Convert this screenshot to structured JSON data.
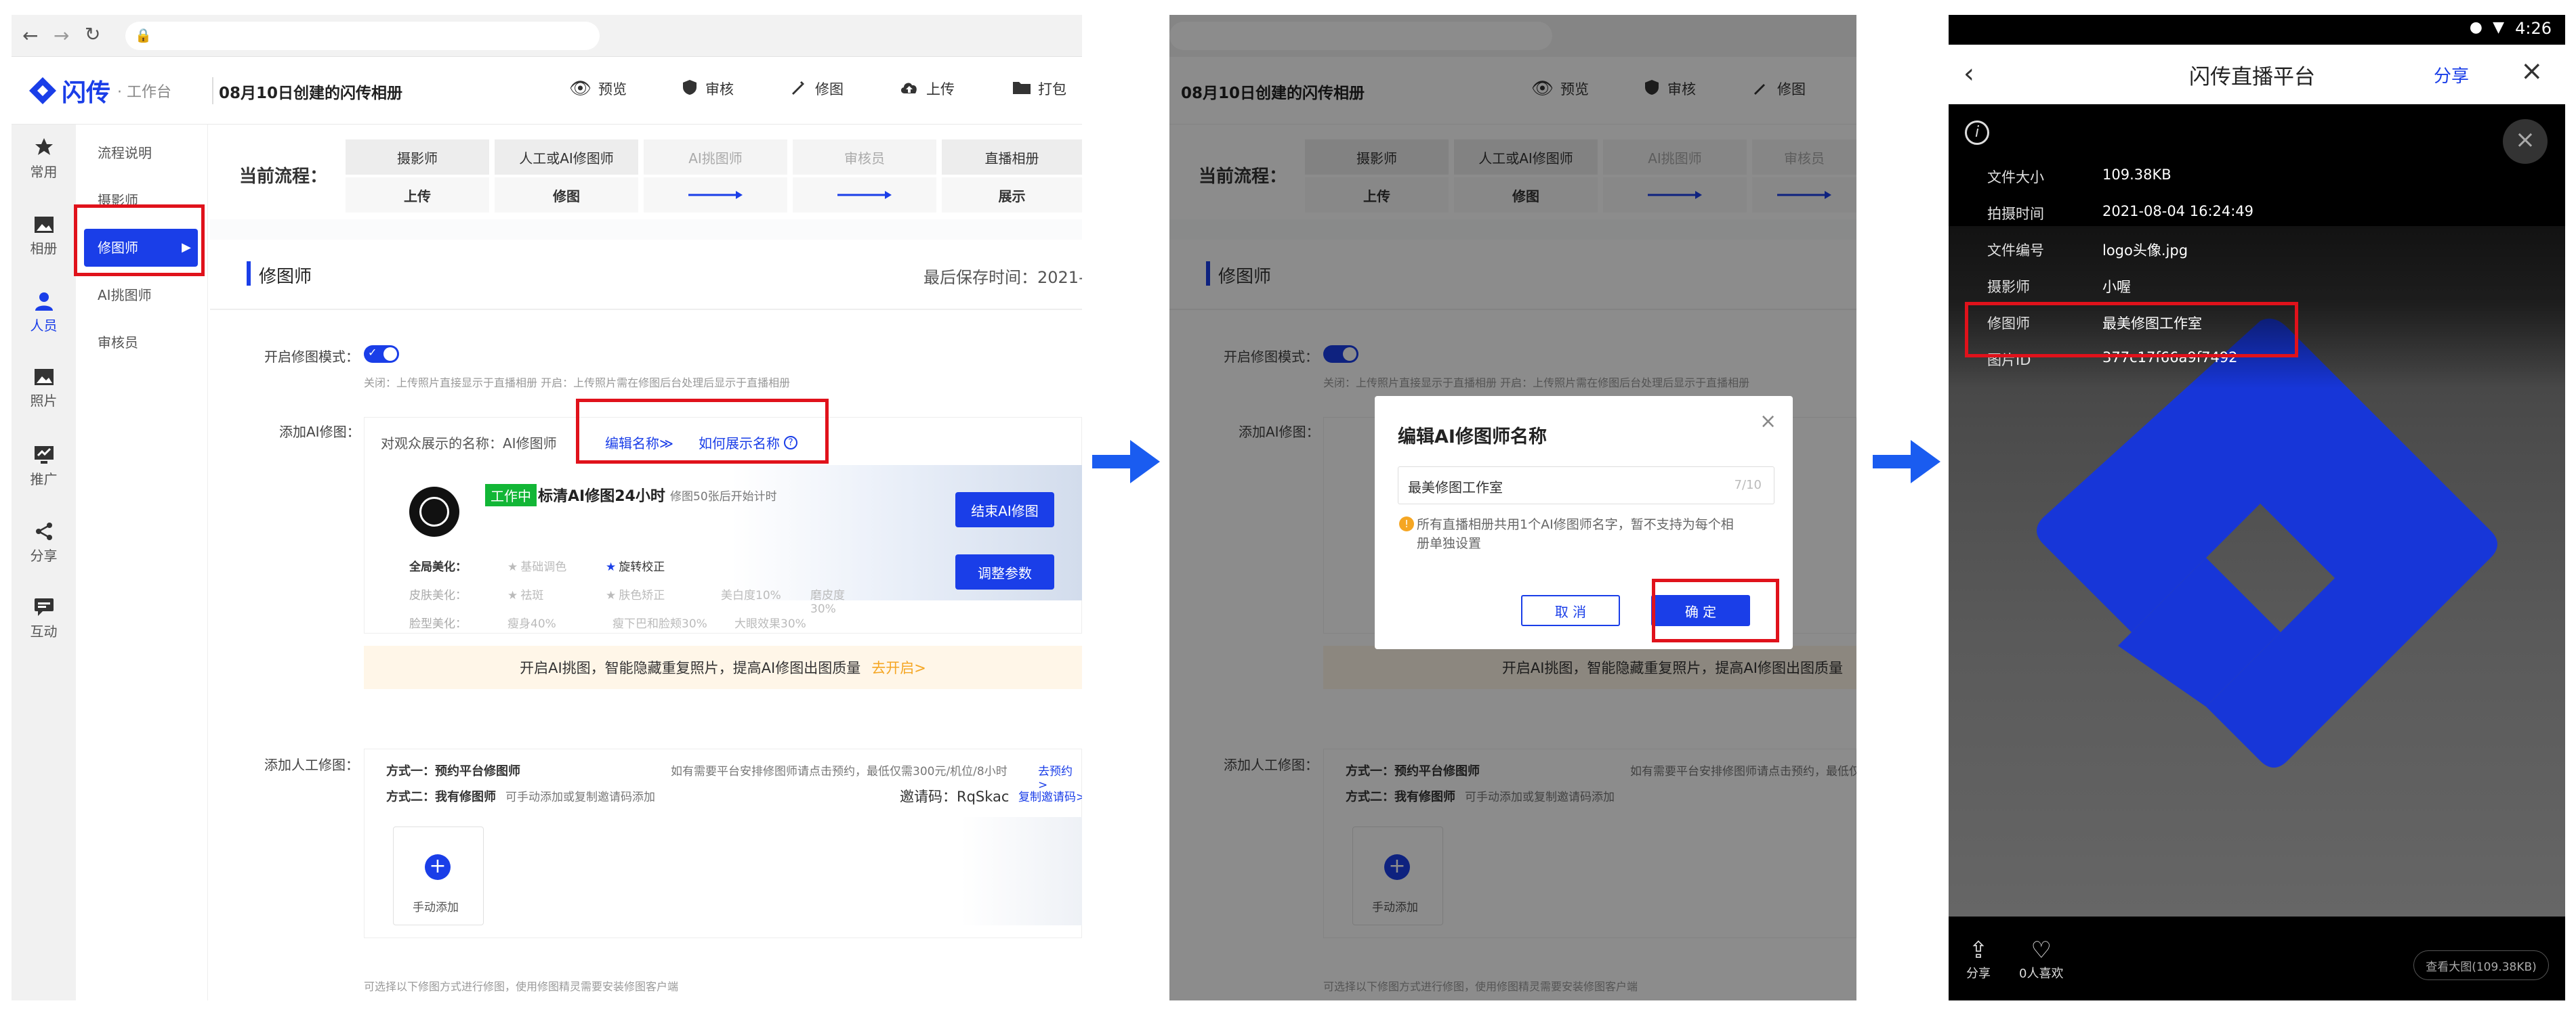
{
  "left": {
    "brand": "闪传",
    "brand_sub": "· 工作台",
    "album_title": "08月10日创建的闪传相册",
    "actions": [
      "预览",
      "审核",
      "修图",
      "上传",
      "打包"
    ],
    "sidebar": [
      "常用",
      "相册",
      "人员",
      "照片",
      "推广",
      "分享",
      "互动"
    ],
    "submenu": [
      "流程说明",
      "摄影师",
      "修图师",
      "AI挑图师",
      "审核员"
    ],
    "flow_label": "当前流程：",
    "flow_roles": [
      "摄影师",
      "人工或AI修图师",
      "AI挑图师",
      "审核员",
      "直播相册"
    ],
    "flow_actions": [
      "上传",
      "修图",
      "",
      "",
      "展示"
    ],
    "section_title": "修图师",
    "save_time": "最后保存时间：2021-",
    "mode_label": "开启修图模式：",
    "mode_desc": "关闭：上传照片直接显示于直播相册   开启：上传照片需在修图后台处理后显示于直播相册",
    "add_ai_label": "添加AI修图：",
    "display_name": "对观众展示的名称：AI修图师",
    "edit_name": "编辑名称≫",
    "how_name": "如何展示名称",
    "ai_badge": "工作中",
    "ai_name": "标清AI修图24小时",
    "ai_note": "修图50张后开始计时",
    "end_btn": "结束AI修图",
    "adjust_btn": "调整参数",
    "beauty_rows": [
      {
        "label": "全局美化：",
        "items": [
          "基础调色",
          "旋转校正"
        ]
      },
      {
        "label": "皮肤美化：",
        "items": [
          "祛斑",
          "肤色矫正",
          "美白度10%",
          "磨皮度30%"
        ]
      },
      {
        "label": "脸型美化：",
        "items": [
          "瘦身40%",
          "瘦下巴和脸颊30%",
          "大眼效果30%"
        ]
      }
    ],
    "tip": "开启AI挑图，智能隐藏重复照片，提高AI修图出图质量",
    "tip_link": "去开启>",
    "manual_label": "添加人工修图：",
    "way1": "方式一：预约平台修图师",
    "way1_desc": "如有需要平台安排修图师请点击预约，最低仅需300元/机位/8小时",
    "way1_link": "去预约>",
    "way2": "方式二：我有修图师",
    "way2_desc": "可手动添加或复制邀请码添加",
    "invite_label": "邀请码：RqSkac",
    "invite_copy": "复制邀请码>",
    "manual_add": "手动添加",
    "bottom_note": "可选择以下修图方式进行修图，使用修图精灵需要安装修图客户端"
  },
  "dialog": {
    "title": "编辑AI修图师名称",
    "value": "最美修图工作室",
    "count": "7/10",
    "note": "所有直播相册共用1个AI修图师名字，暂不支持为每个相册单独设置",
    "cancel": "取 消",
    "ok": "确 定"
  },
  "phone": {
    "time": "4:26",
    "title": "闪传直播平台",
    "share": "分享",
    "meta": [
      {
        "k": "文件大小",
        "v": "109.38KB"
      },
      {
        "k": "拍摄时间",
        "v": "2021-08-04 16:24:49"
      },
      {
        "k": "文件编号",
        "v": "logo头像.jpg"
      },
      {
        "k": "摄影师",
        "v": "小喔"
      },
      {
        "k": "修图师",
        "v": "最美修图工作室"
      },
      {
        "k": "图片ID",
        "v": "377c17f66a9f7492"
      }
    ],
    "share_bottom": "分享",
    "likes": "0人喜欢",
    "view_big": "查看大图(109.38KB)"
  },
  "colors": {
    "accent": "#1a3ee8",
    "highlight": "#e0121b",
    "tip_bg": "#fff6e8"
  }
}
